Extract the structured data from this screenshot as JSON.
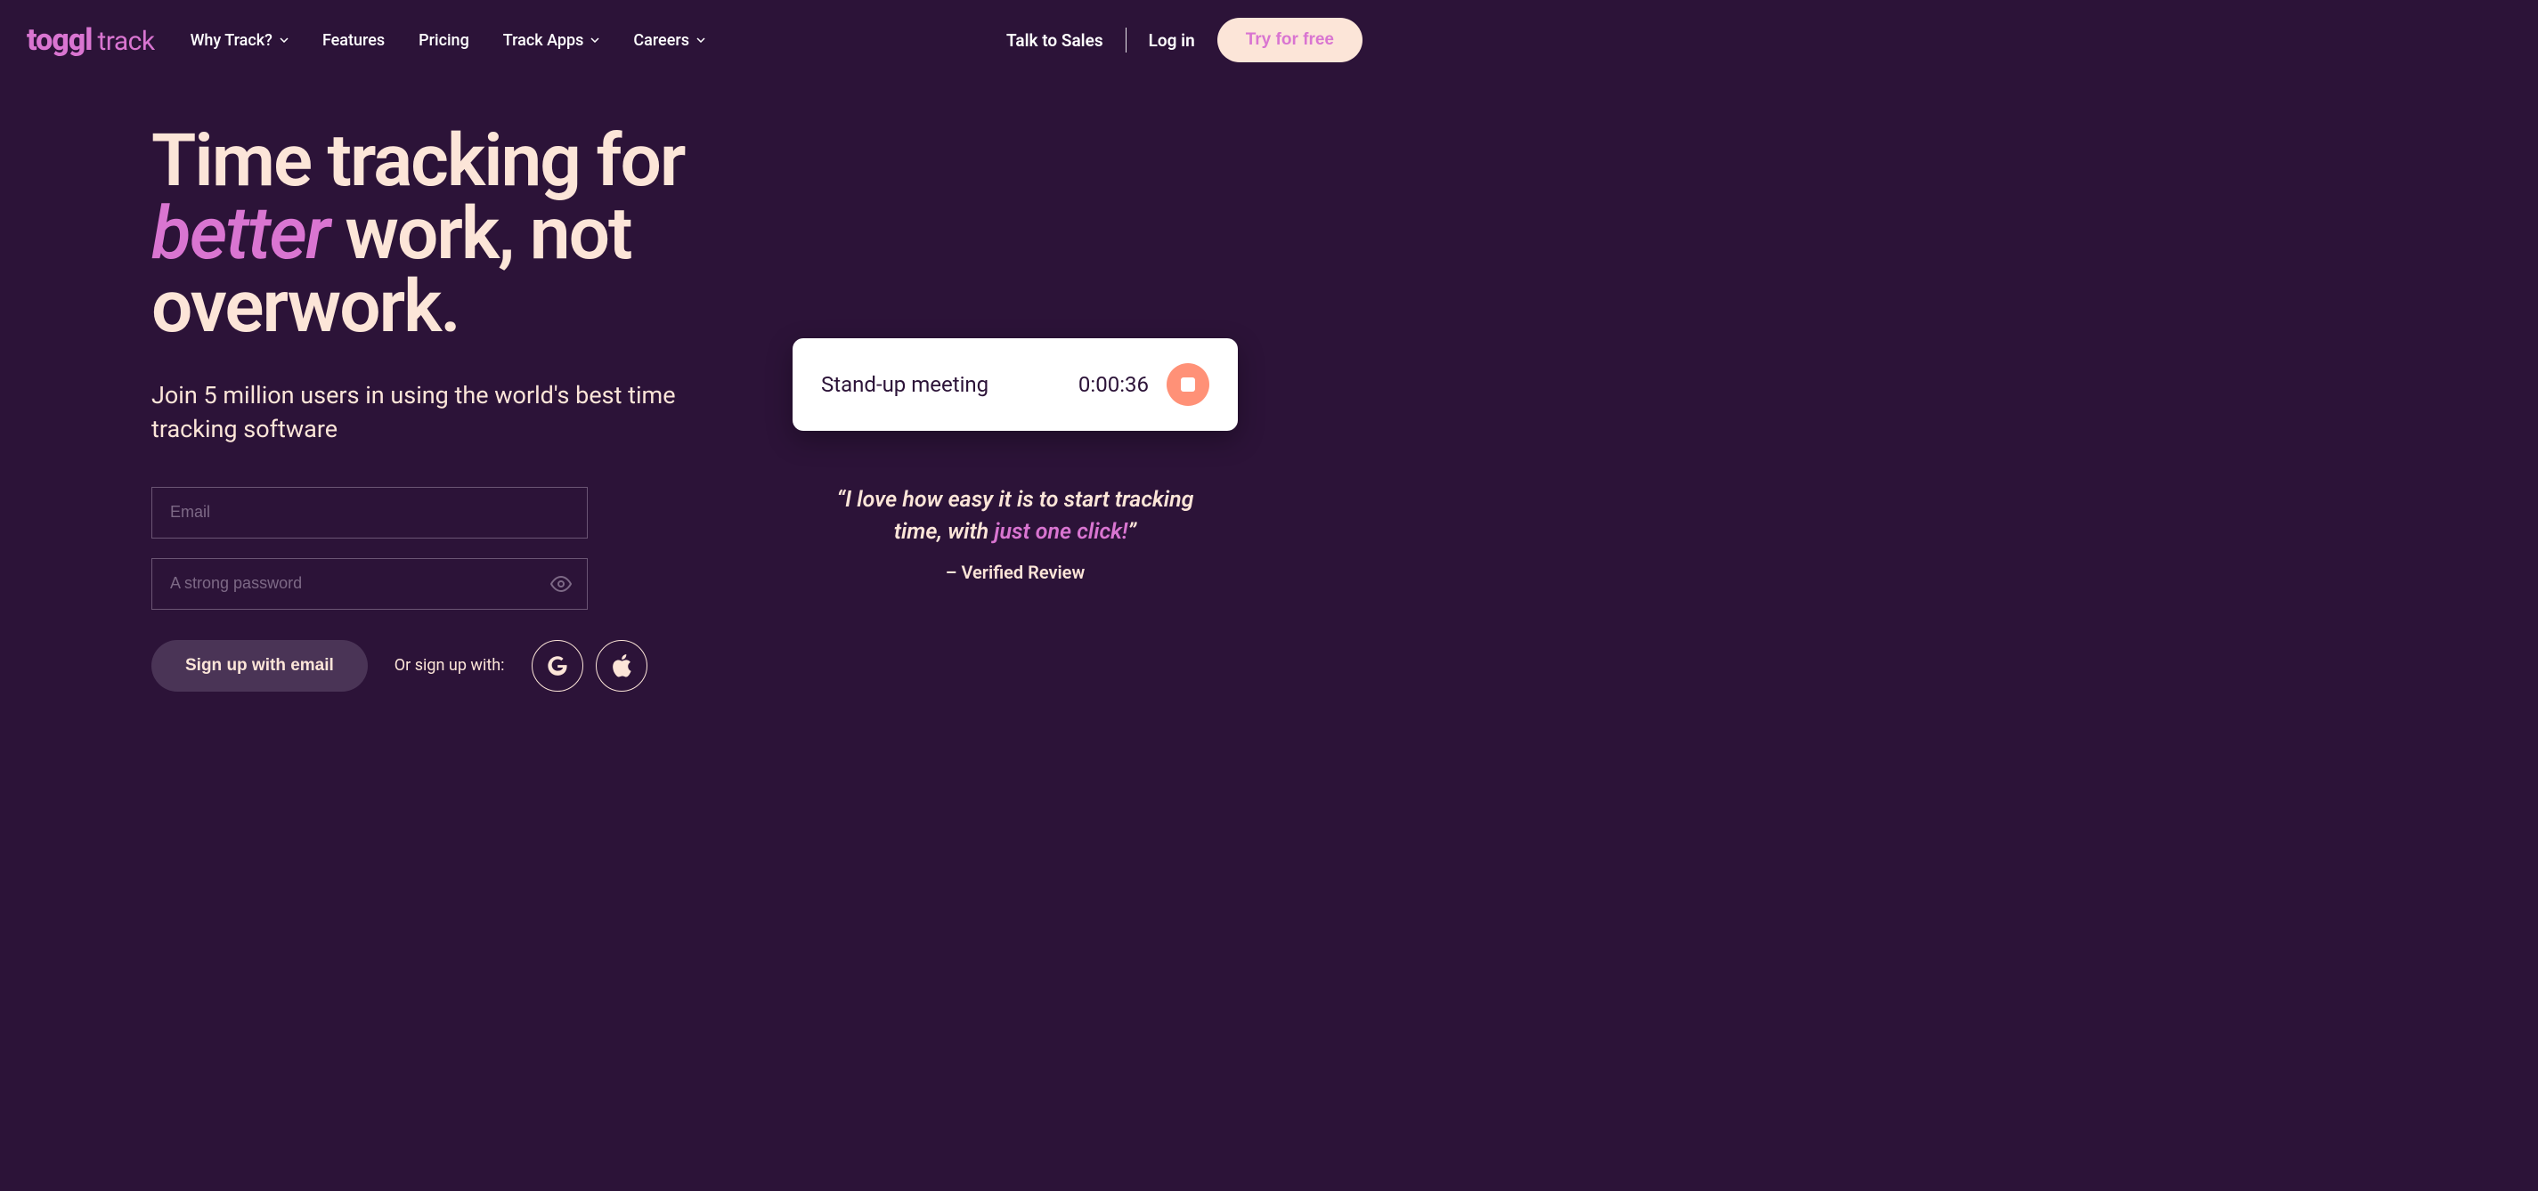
{
  "logo": {
    "primary": "toggl",
    "secondary": "track"
  },
  "nav": {
    "why_track": "Why Track?",
    "features": "Features",
    "pricing": "Pricing",
    "track_apps": "Track Apps",
    "careers": "Careers"
  },
  "header_right": {
    "talk_to_sales": "Talk to Sales",
    "log_in": "Log in",
    "try_free": "Try for free"
  },
  "hero": {
    "title_pre": "Time tracking for ",
    "title_italic": "better",
    "title_post": " work, not overwork.",
    "subtitle": "Join 5 million users in using the world's best time tracking software"
  },
  "form": {
    "email_placeholder": "Email",
    "password_placeholder": "A strong password",
    "signup_email": "Sign up with email",
    "or_text": "Or sign up with:"
  },
  "timer": {
    "label": "Stand-up meeting",
    "time": "0:00:36"
  },
  "quote": {
    "pre": "“I love how easy it is to start tracking time, with ",
    "emph": "just one click!",
    "post": "”",
    "attribution": "– Verified Review"
  }
}
